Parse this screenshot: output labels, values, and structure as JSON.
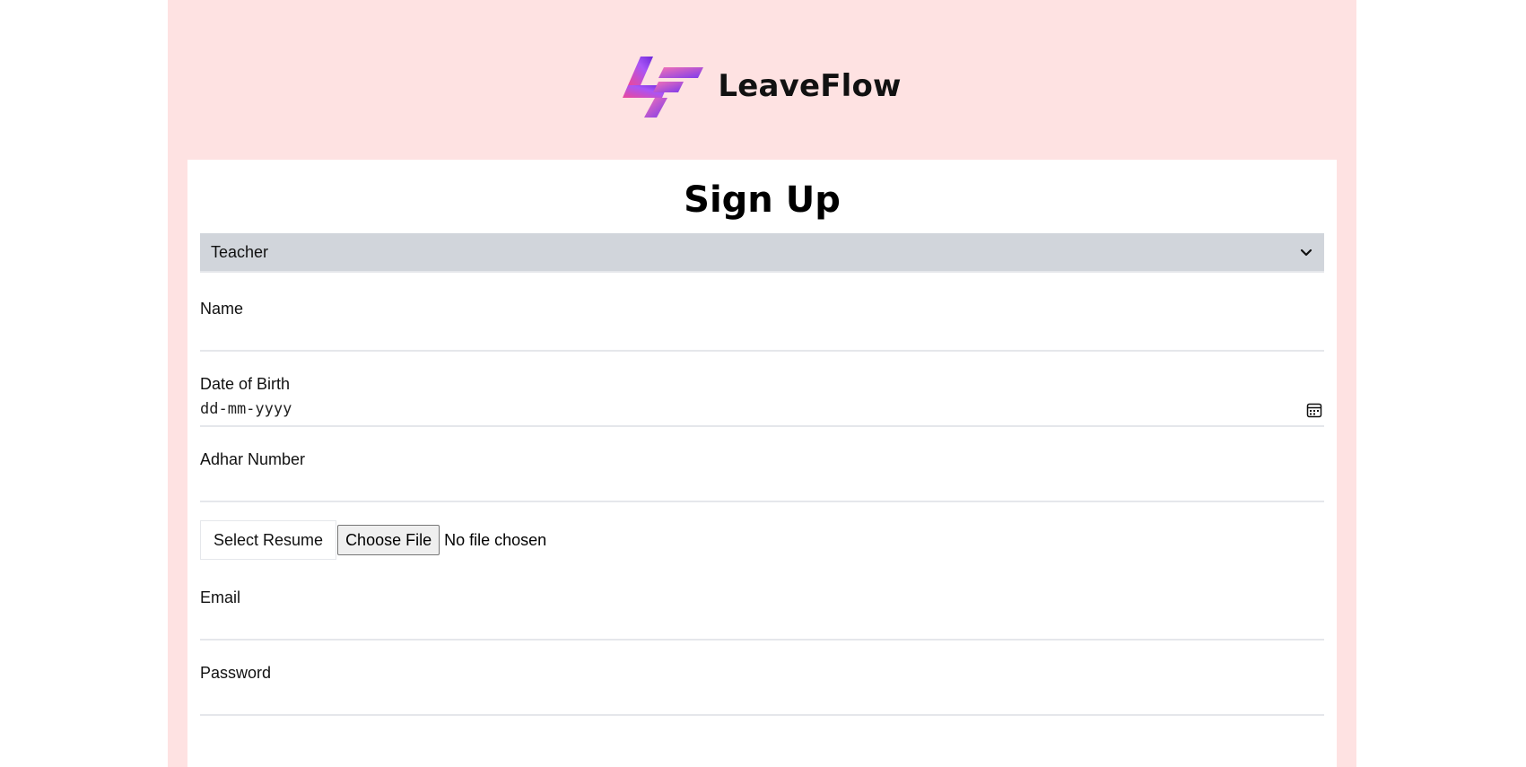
{
  "brand": {
    "name": "LeaveFlow"
  },
  "form": {
    "title": "Sign Up",
    "role": {
      "selected": "Teacher"
    },
    "fields": {
      "name": {
        "label": "Name",
        "value": ""
      },
      "dob": {
        "label": "Date of Birth",
        "placeholder": "dd-mm-yyyy"
      },
      "adhar": {
        "label": "Adhar Number",
        "value": ""
      },
      "email": {
        "label": "Email",
        "value": ""
      },
      "password": {
        "label": "Password",
        "value": ""
      }
    },
    "resume": {
      "label": "Select Resume",
      "button": "Choose File",
      "status": "No file chosen"
    }
  },
  "colors": {
    "page_bg": "#fee2e2",
    "card_bg": "#ffffff",
    "select_bg": "#d1d5db",
    "logo_pink": "#ec4899",
    "logo_purple": "#7c3aed"
  }
}
